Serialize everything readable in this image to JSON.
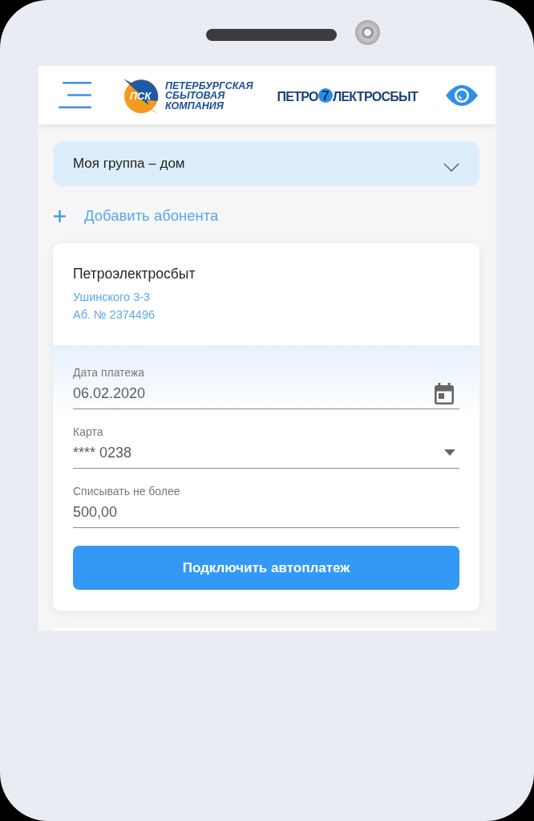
{
  "header": {
    "emblem": "ПСК",
    "company_name": [
      "ПЕТЕРБУРГСКАЯ",
      "СБЫТОВАЯ",
      "КОМПАНИЯ"
    ],
    "brand": {
      "before": "ПЕТРО",
      "mark": "7",
      "after": "ЛЕКТРОСБЫТ"
    }
  },
  "group_select": {
    "value": "Моя группа – дом"
  },
  "add_subscriber": {
    "label": "Добавить абонента"
  },
  "accounts": [
    {
      "provider": "Петроэлектросбыт",
      "address": "Ушинского 3-3",
      "account_number": "Аб. № 2374496",
      "fields": [
        {
          "kind": "date",
          "label": "Дата платежа",
          "value": "06.02.2020"
        },
        {
          "kind": "select",
          "label": "Карта",
          "value": "**** 0238"
        },
        {
          "kind": "text",
          "label": "Списывать не более",
          "value": "500,00"
        }
      ],
      "button": "Подключить автоплатеж"
    }
  ]
}
